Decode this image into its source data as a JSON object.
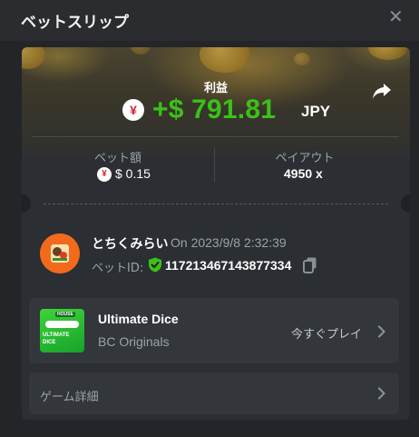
{
  "header": {
    "title": "ベットスリップ",
    "close_glyph": "✕"
  },
  "profit": {
    "label": "利益",
    "currency_symbol": "¥",
    "amount": "+$ 791.81",
    "currency": "JPY",
    "amount_color": "#3bc117"
  },
  "stats": {
    "bet_label": "ベット額",
    "bet_value": "$ 0.15",
    "payout_label": "ペイアウト",
    "payout_value": "4950 x"
  },
  "bet_info": {
    "user_name": "とちくみらい",
    "time": "On 2023/9/8 2:32:39",
    "bet_id_label": "ベットID:",
    "bet_id": "117213467143877334"
  },
  "game": {
    "title": "Ultimate Dice",
    "provider": "BC Originals",
    "play_label": "今すぐプレイ",
    "thumb_badge": "HOUSE",
    "thumb_title_1": "ULTIMATE",
    "thumb_title_2": "DICE"
  },
  "details": {
    "label": "ゲーム詳細"
  },
  "icons": {
    "close": "close-icon",
    "share": "share-icon",
    "currency": "yen-icon",
    "verified": "shield-check-icon",
    "copy": "copy-icon",
    "chevron": "chevron-right-icon"
  }
}
